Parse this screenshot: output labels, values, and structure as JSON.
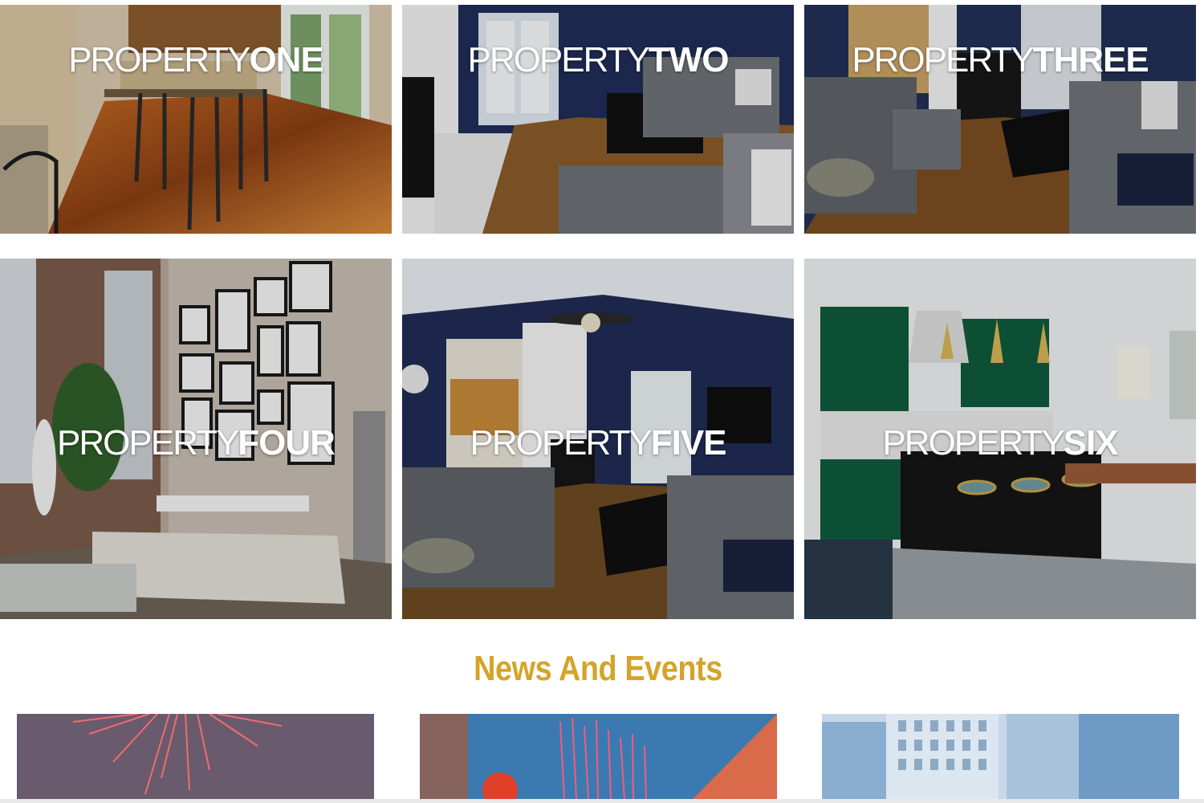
{
  "properties": [
    {
      "label_light": "PROPERTY",
      "label_bold": "ONE",
      "scene": "kitchen-bar-hardwood"
    },
    {
      "label_light": "PROPERTY",
      "label_bold": "TWO",
      "scene": "navy-living-room-fireplace"
    },
    {
      "label_light": "PROPERTY",
      "label_bold": "THREE",
      "scene": "living-room-gray-sofa"
    },
    {
      "label_light": "PROPERTY",
      "label_bold": "FOUR",
      "scene": "brick-loft-gallery-wall"
    },
    {
      "label_light": "PROPERTY",
      "label_bold": "FIVE",
      "scene": "vaulted-living-room-ceiling-fan"
    },
    {
      "label_light": "PROPERTY",
      "label_bold": "SIX",
      "scene": "green-kitchen-marble-island"
    }
  ],
  "news": {
    "title": "News And Events",
    "cards": [
      {
        "scene": "fireworks-purple-sky"
      },
      {
        "scene": "fireworks-blue-sky"
      },
      {
        "scene": "glass-office-towers"
      }
    ]
  },
  "colors": {
    "accent": "#d4a42a",
    "title_text": "#ffffff"
  }
}
